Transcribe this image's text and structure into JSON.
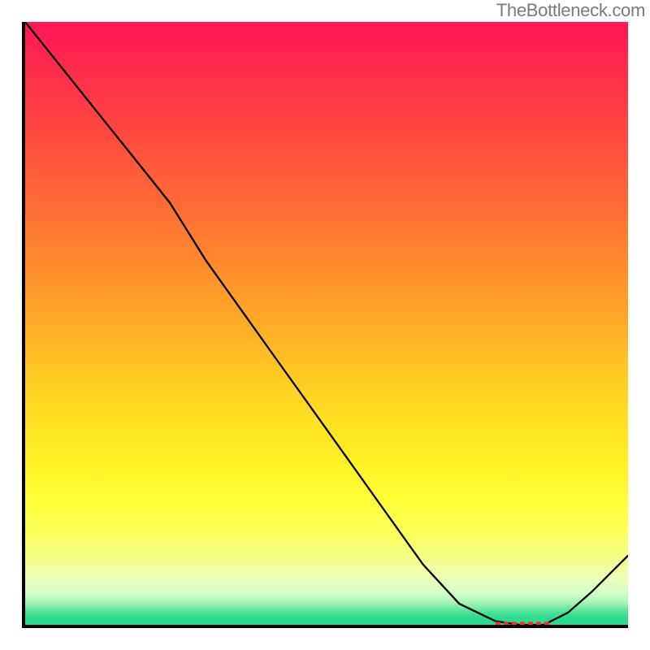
{
  "watermark": "TheBottleneck.com",
  "chart_data": {
    "type": "line",
    "x": [
      0.0,
      0.06,
      0.12,
      0.18,
      0.24,
      0.3,
      0.36,
      0.42,
      0.48,
      0.54,
      0.6,
      0.66,
      0.72,
      0.78,
      0.82,
      0.86,
      0.9,
      0.94,
      1.0
    ],
    "values": [
      1.0,
      0.925,
      0.85,
      0.775,
      0.7,
      0.604,
      0.52,
      0.436,
      0.352,
      0.268,
      0.184,
      0.1,
      0.035,
      0.006,
      0.0,
      0.0,
      0.02,
      0.055,
      0.115
    ],
    "title": "",
    "xlabel": "",
    "ylabel": "",
    "xlim": [
      0,
      1
    ],
    "ylim": [
      0,
      1
    ],
    "annotations": [
      {
        "type": "dashed-segment",
        "x0": 0.78,
        "x1": 0.87,
        "y": 0.002,
        "color": "#ff2a2a"
      }
    ]
  }
}
